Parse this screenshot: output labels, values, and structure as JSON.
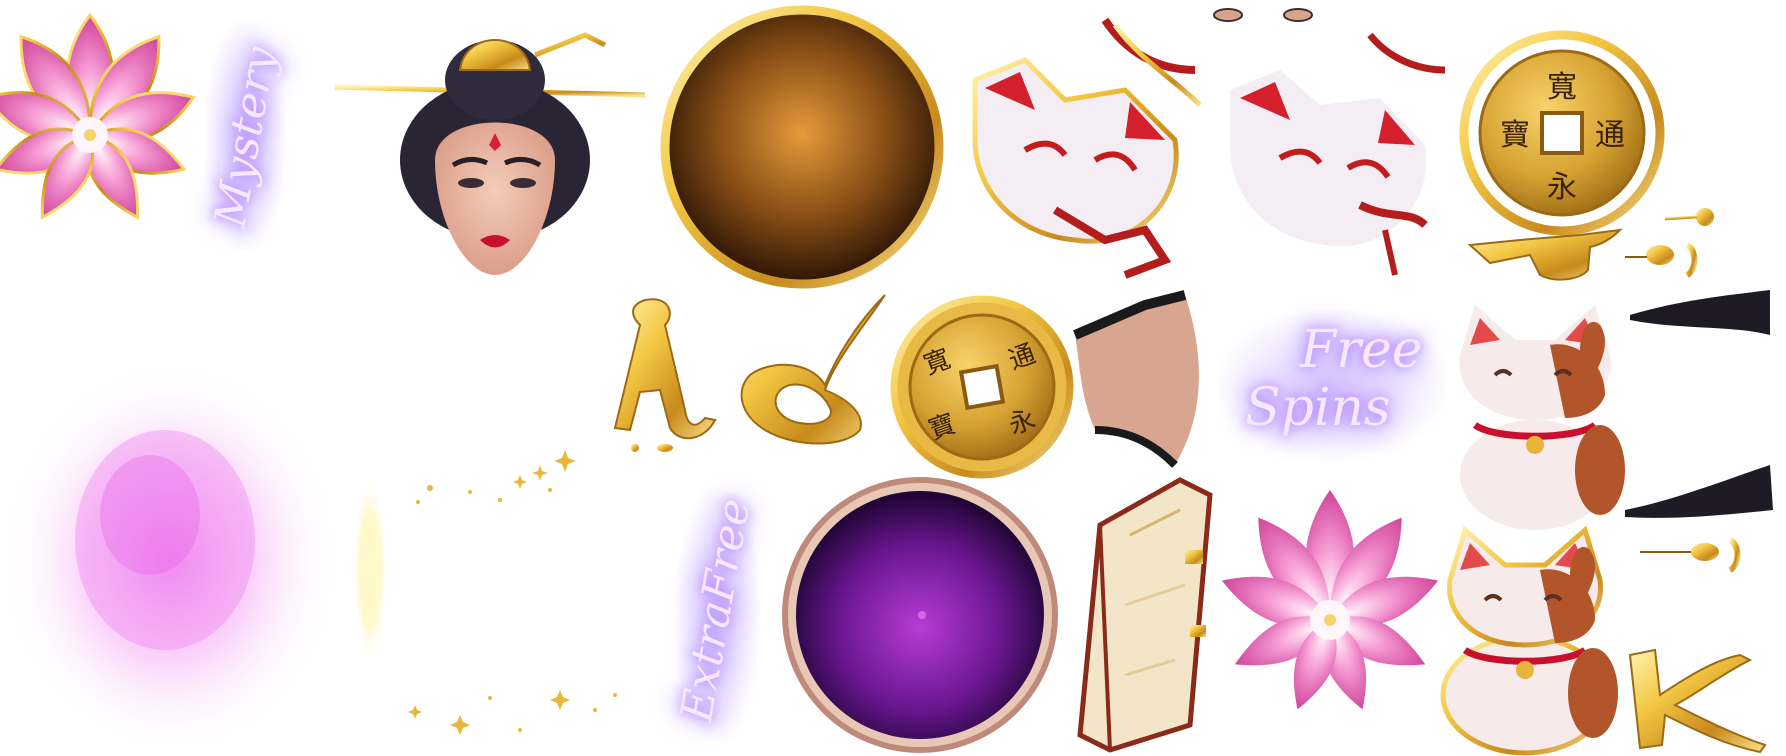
{
  "labels": {
    "mystery": "Mystery",
    "free": "Free",
    "spins": "Spins",
    "extra_free": "ExtraFree",
    "letter_a": "A",
    "letter_q": "Q",
    "letter_j": "J",
    "letter_k": "K"
  },
  "coin_characters": [
    "寬",
    "通",
    "永",
    "寶"
  ],
  "colors": {
    "gold": "#e7b53a",
    "gold_dark": "#a8741a",
    "lotus_pink": "#ef7fc8",
    "purple_orb": "#7a1fa3",
    "bronze_orb": "#c27a2a",
    "glow_purple": "#b388ff"
  },
  "sprites": [
    "lotus-icon",
    "geisha-icon",
    "bronze-orb-icon",
    "fox-mask-icon",
    "fox-mask-icon",
    "coin-icon",
    "letter-j-icon",
    "letter-a-icon",
    "letter-q-icon",
    "coin-icon",
    "maneki-neko-icon",
    "pink-smoke-icon",
    "sparkles-icon",
    "purple-orb-icon",
    "book-icon",
    "lotus-icon",
    "maneki-neko-icon",
    "letter-k-icon",
    "hair-tassel-icon"
  ]
}
